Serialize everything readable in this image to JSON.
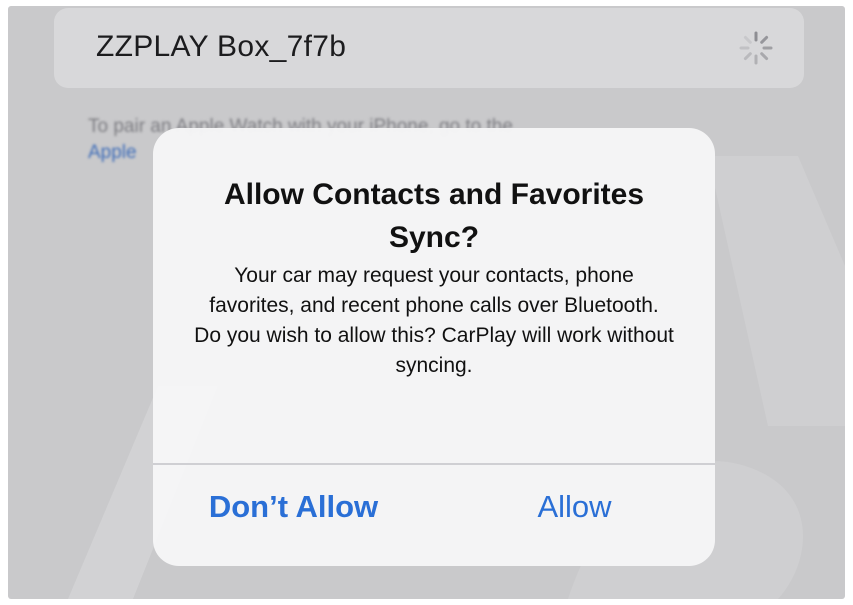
{
  "header": {
    "device_name": "ZZPLAY Box_7f7b",
    "status_icon": "loading-spinner-icon"
  },
  "background_text": {
    "line1": "To pair an Apple Watch with your iPhone, go to the",
    "link": "Apple"
  },
  "alert": {
    "title": "Allow Contacts and Favorites Sync?",
    "message": "Your car may request your contacts, phone favorites, and recent phone calls over Bluetooth. Do you wish to allow this? CarPlay will work without syncing.",
    "buttons": {
      "dont_allow": "Don’t Allow",
      "allow": "Allow"
    }
  },
  "colors": {
    "accent": "#2a6fd6",
    "background": "#c9c9cb",
    "alert_background": "#f6f6f7"
  }
}
